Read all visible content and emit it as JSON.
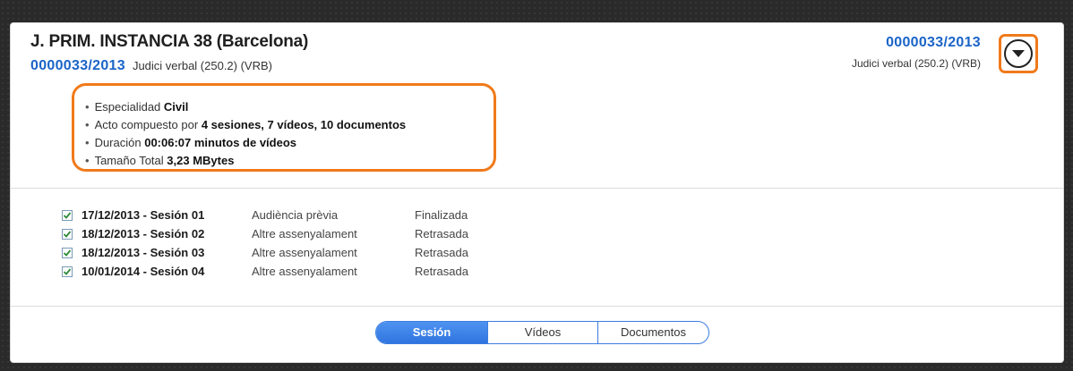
{
  "header": {
    "court": "J. PRIM. INSTANCIA 38 (Barcelona)",
    "case_number": "0000033/2013",
    "procedure": "Judici verbal (250.2) (VRB)",
    "case_number_right": "0000033/2013",
    "procedure_right": "Judici verbal (250.2) (VRB)"
  },
  "details": {
    "specialty_label": "Especialidad",
    "specialty_value": "Civil",
    "composition_label": "Acto compuesto por",
    "composition_value": "4 sesiones, 7 vídeos, 10 documentos",
    "duration_label": "Duración",
    "duration_value": "00:06:07 minutos de vídeos",
    "size_label": "Tamaño Total",
    "size_value": "3,23 MBytes"
  },
  "sessions": [
    {
      "date": "17/12/2013 - Sesión 01",
      "type": "Audiència prèvia",
      "status": "Finalizada",
      "checked": true
    },
    {
      "date": "18/12/2013 - Sesión 02",
      "type": "Altre assenyalament",
      "status": "Retrasada",
      "checked": true
    },
    {
      "date": "18/12/2013 - Sesión 03",
      "type": "Altre assenyalament",
      "status": "Retrasada",
      "checked": true
    },
    {
      "date": "10/01/2014 - Sesión 04",
      "type": "Altre assenyalament",
      "status": "Retrasada",
      "checked": true
    }
  ],
  "tabs": [
    {
      "label": "Sesión",
      "active": true
    },
    {
      "label": "Vídeos",
      "active": false
    },
    {
      "label": "Documentos",
      "active": false
    }
  ],
  "colors": {
    "accent_blue": "#1a64c8",
    "highlight_orange": "#f07a1a",
    "tab_active": "#3b7de0",
    "checkbox_check": "#2e8b3a"
  },
  "icons": {
    "toggle": "chevron-down-circle-icon",
    "checkbox": "checkbox-checked-icon"
  }
}
